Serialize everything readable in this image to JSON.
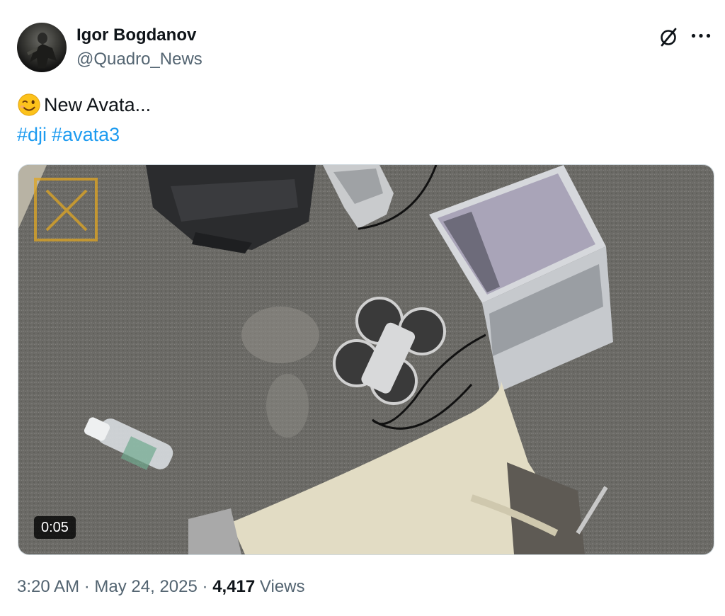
{
  "author": {
    "display_name": "Igor Bogdanov",
    "handle": "@Quadro_News",
    "avatar_icon": "profile-photo"
  },
  "actions": {
    "grok_icon": "grok-icon",
    "more_icon": "more-options-icon"
  },
  "tweet": {
    "emoji": "winking-face",
    "text": "New Avata...",
    "hashtags": [
      "#dji",
      "#avata3"
    ]
  },
  "media": {
    "type": "video",
    "duration": "0:05"
  },
  "meta": {
    "time": "3:20 AM",
    "separator": "·",
    "date": "May 24, 2025",
    "views_count": "4,417",
    "views_label": "Views"
  },
  "colors": {
    "link": "#1d9bf0",
    "secondary_text": "#536471",
    "primary_text": "#0f1419"
  }
}
